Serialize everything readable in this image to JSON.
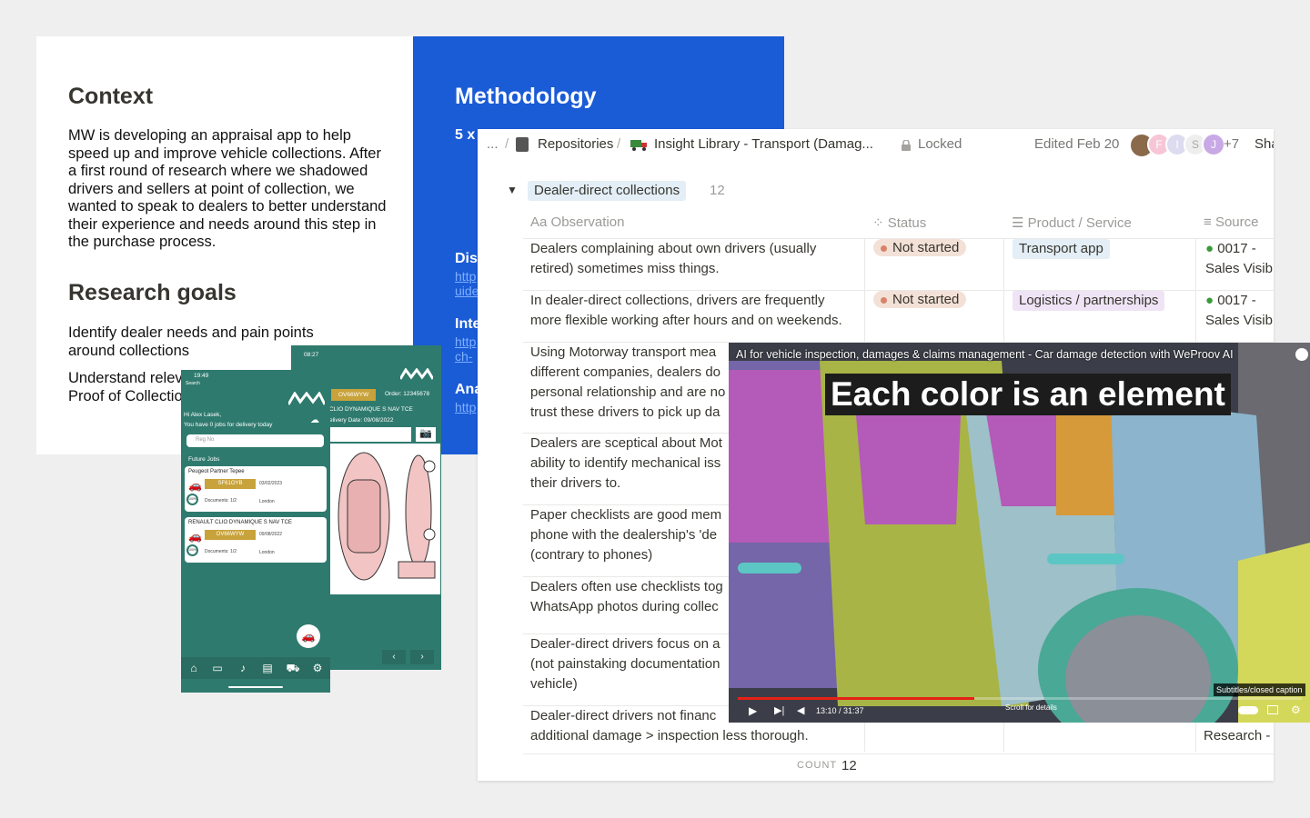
{
  "slide": {
    "context_title": "Context",
    "context_body": "MW is developing an appraisal app to help speed up and improve vehicle collections. After a first round of research where we shadowed drivers and sellers at point of collection, we wanted to speak to dealers to better understand their experience and needs around this step in the purchase process.",
    "goals_title": "Research goals",
    "goal_1": "Identify dealer needs and pain points around collections",
    "goal_2_partial": "Understand relev",
    "goal_2b_partial": "Proof of Collectio",
    "methodology_title": "Methodology",
    "method_partial": "5 x",
    "dis_partial": "Dis",
    "dis_link_1": "http",
    "dis_link_2": "uide",
    "int_partial": "Inte",
    "int_link_1": "http",
    "int_link_2": "ch-",
    "ana_partial": "Ana",
    "ana_link": "http"
  },
  "notion": {
    "breadcrumb_more": "...",
    "crumb_1": "Repositories",
    "crumb_sep": "/",
    "crumb_2": "Insight Library - Transport (Damag...",
    "locked": "Locked",
    "edited": "Edited Feb 20",
    "avatars": [
      "F",
      "I",
      "S",
      "J"
    ],
    "avatar_more": "+7",
    "share_partial": "Sha",
    "group_name": "Dealer-direct collections",
    "group_count": "12",
    "columns": {
      "observation": "Observation",
      "observation_prefix": "Aa",
      "status": "Status",
      "product": "Product / Service",
      "source": "Source"
    },
    "rows": [
      {
        "obs_1": "Dealers complaining about own drivers (usually",
        "obs_2": "retired) sometimes miss things.",
        "status": "Not started",
        "product": "Transport app",
        "source_1": "0017 -",
        "source_2": "Sales Visib"
      },
      {
        "obs_1": "In dealer-direct collections, drivers are frequently",
        "obs_2": "more flexible working after hours and on weekends.",
        "status": "Not started",
        "product": "Logistics / partnerships",
        "source_1": "0017 -",
        "source_2": "Sales Visib"
      },
      {
        "obs_1": "Using Motorway transport mea",
        "obs_2": "different companies, dealers do",
        "obs_3": "personal relationship and are no",
        "obs_4": "trust these drivers to pick up da"
      },
      {
        "obs_1": "Dealers are sceptical about Mot",
        "obs_2": "ability to identify mechanical iss",
        "obs_3": "their drivers to."
      },
      {
        "obs_1": "Paper checklists are good mem",
        "obs_2": "phone with the dealership's 'de",
        "obs_3": "(contrary to phones)"
      },
      {
        "obs_1": "Dealers often use checklists tog",
        "obs_2": "WhatsApp photos during collec"
      },
      {
        "obs_1": "Dealer-direct drivers focus on a",
        "obs_2": "(not painstaking documentation",
        "obs_3": "vehicle)"
      },
      {
        "obs_1": "Dealer-direct drivers not financ",
        "obs_2": "additional damage > inspection less thorough.",
        "source_partial": "Research -"
      }
    ],
    "count_label": "COUNT",
    "count_value": "12"
  },
  "video": {
    "title": "AI for vehicle inspection, damages & claims management - Car damage detection with WeProov AI",
    "caption": "Each color is an element",
    "time": "13:10 / 31:37",
    "scroll_hint": "Scroll for details",
    "subtitles": "Subtitles/closed caption",
    "progress": 0.42
  },
  "phone1": {
    "time": "19:49",
    "search": "Search",
    "greeting": "Hi Alex Lasek,",
    "jobs_msg": "You have 0 jobs for delivery today",
    "reg_placeholder": "Reg No",
    "future_jobs": "Future Jobs",
    "card1_title": "Peugeot Partner Tepee",
    "card1_reg": "SF61OYB",
    "card1_date": "03/02/2023",
    "card1_docs": "Documents: 1/2",
    "card1_loc": "London",
    "card1_pct": "100%",
    "card2_title": "RENAULT CLIO DYNAMIQUE S NAV TCE",
    "card2_reg": "OV66WYW",
    "card2_date": "09/08/2022",
    "card2_docs": "Documents: 1/2",
    "card2_loc": "London",
    "card2_pct": "100%"
  },
  "phone2": {
    "time": "08:27",
    "reg": "OV66WYW",
    "order": "Order: 12345678",
    "model": "CLIO DYNAMIQUE S NAV TCE",
    "delivery": "elivery Date: 09/08/2022"
  }
}
